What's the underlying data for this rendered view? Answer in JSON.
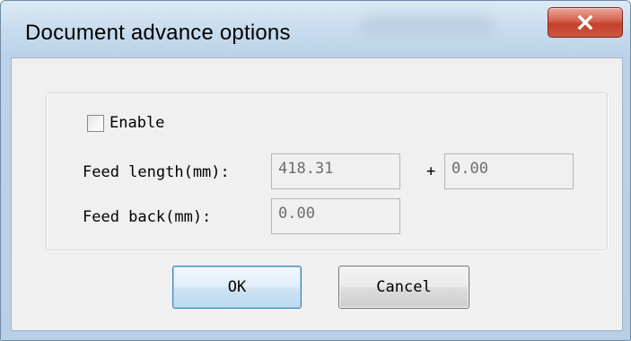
{
  "window": {
    "title": "Document advance options"
  },
  "enable": {
    "label": "Enable",
    "checked": false
  },
  "feed_length": {
    "label": "Feed length(mm):",
    "value": "418.31",
    "plus": "+",
    "offset_value": "0.00"
  },
  "feed_back": {
    "label": "Feed back(mm):",
    "value": "0.00"
  },
  "buttons": {
    "ok": "OK",
    "cancel": "Cancel"
  },
  "icons": {
    "close": "close-icon"
  },
  "colors": {
    "close_button": "#c94a35",
    "ok_border": "#3c7fb1",
    "dialog_bg": "#f0f0f0"
  }
}
